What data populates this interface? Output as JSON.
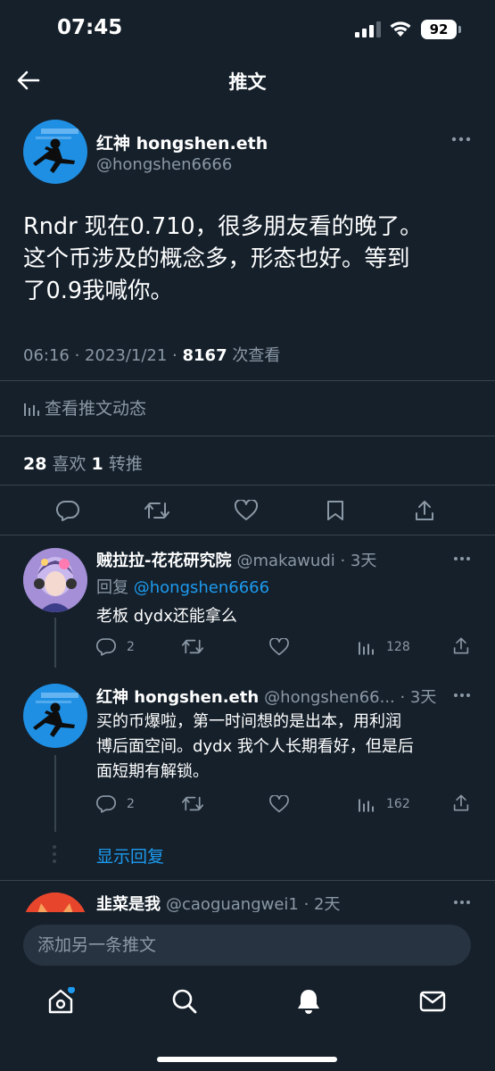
{
  "status_bar": {
    "time": "07:45",
    "battery": "92"
  },
  "header": {
    "title": "推文"
  },
  "tweet": {
    "author_name": "红神 hongshen.eth",
    "author_handle": "@hongshen6666",
    "text_lines": [
      "Rndr 现在0.710，很多朋友看的晚了。",
      "这个币涉及的概念多，形态也好。等到",
      "了0.9我喊你。"
    ],
    "time": "06:16 · 2023/1/21 · ",
    "views": "8167",
    "views_label": " 次查看",
    "activity_label": "查看推文动态",
    "likes": "28",
    "likes_label": " 喜欢  ",
    "retweets": "1",
    "retweets_label": " 转推"
  },
  "replies": [
    {
      "name": "贼拉拉-花花研究院",
      "handle": "@makawudi",
      "time": " · 3天",
      "reply_to_label": "回复 ",
      "reply_to": "@hongshen6666",
      "text": "老板 dydx还能拿么",
      "reply_count": "2",
      "views": "128"
    },
    {
      "name": "红神 hongshen.eth",
      "handle": "@hongshen66...",
      "time": " · 3天",
      "text_lines": [
        "买的币爆啦，第一时间想的是出本，用利润",
        "博后面空间。dydx 我个人长期看好，但是后",
        "面短期有解锁。"
      ],
      "reply_count": "2",
      "views": "162"
    },
    {
      "name": "韭菜是我",
      "handle": "@caoguangwei1",
      "time": " · 2天"
    }
  ],
  "show_replies": "显示回复",
  "compose": {
    "placeholder": "添加另一条推文"
  },
  "colors": {
    "background": "#15202b",
    "accent": "#1d9bf0",
    "muted": "#8b98a5",
    "divider": "#38444d"
  }
}
